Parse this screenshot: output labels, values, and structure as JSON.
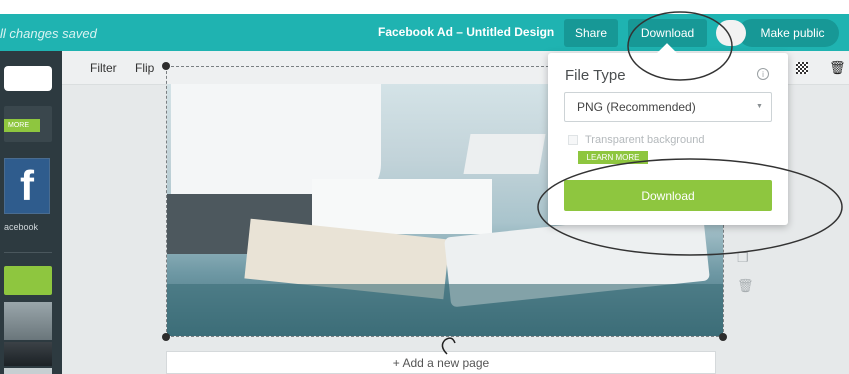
{
  "header": {
    "save_status": "ll changes saved",
    "design_title": "Facebook Ad – Untitled Design",
    "share_label": "Share",
    "download_label": "Download",
    "make_public_label": "Make public"
  },
  "sidebar": {
    "more_label": "MORE",
    "template_label": "acebook",
    "facebook_glyph": "f"
  },
  "toolbar": {
    "filter_label": "Filter",
    "flip_label": "Flip"
  },
  "download_panel": {
    "title": "File Type",
    "selected_file_type": "PNG (Recommended)",
    "transparent_label": "Transparent background",
    "learn_more_label": "LEARN MORE",
    "download_label": "Download"
  },
  "canvas": {
    "add_page_label": "+ Add a new page"
  },
  "colors": {
    "topbar": "#1fb3b1",
    "accent_green": "#8ec63f",
    "sidebar": "#2d3a40"
  }
}
